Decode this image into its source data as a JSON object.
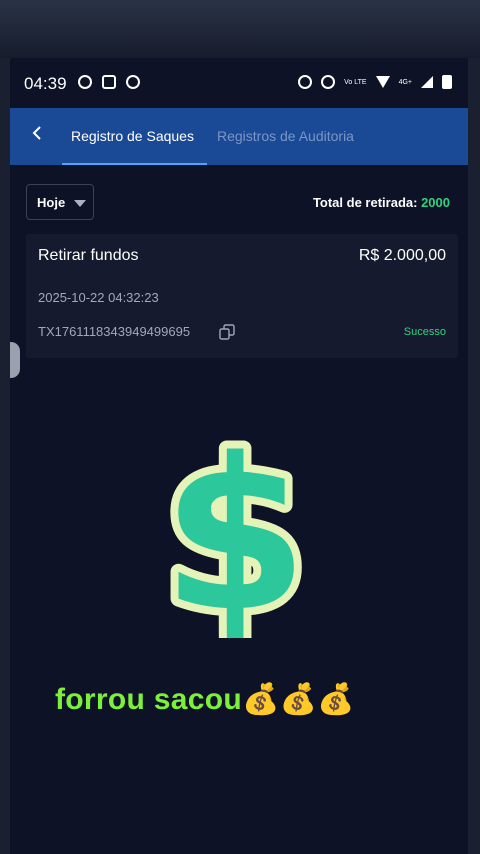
{
  "status_bar": {
    "time": "04:39",
    "right_label": "4G+",
    "volte": "Vo LTE"
  },
  "header": {
    "back_icon": "chevron-left-icon",
    "tabs": [
      {
        "label": "Registro de Saques",
        "active": true
      },
      {
        "label": "Registros de Auditoria",
        "active": false
      }
    ]
  },
  "filter": {
    "selected": "Hoje",
    "total_label": "Total de retirada:",
    "total_value": "2000"
  },
  "record": {
    "title": "Retirar fundos",
    "amount": "R$ 2.000,00",
    "datetime": "2025-10-22 04:32:23",
    "tx_id": "TX1761118343949499695",
    "status": "Sucesso"
  },
  "overlay": {
    "sticker_symbol": "$",
    "caption": "forrou sacou💰💰💰"
  },
  "colors": {
    "header_bg": "#1a4a96",
    "accent_green": "#2fd37f",
    "caption_green": "#7cf03a",
    "dollar_fill": "#2cc79a",
    "dollar_outline": "#e6f3b8"
  }
}
